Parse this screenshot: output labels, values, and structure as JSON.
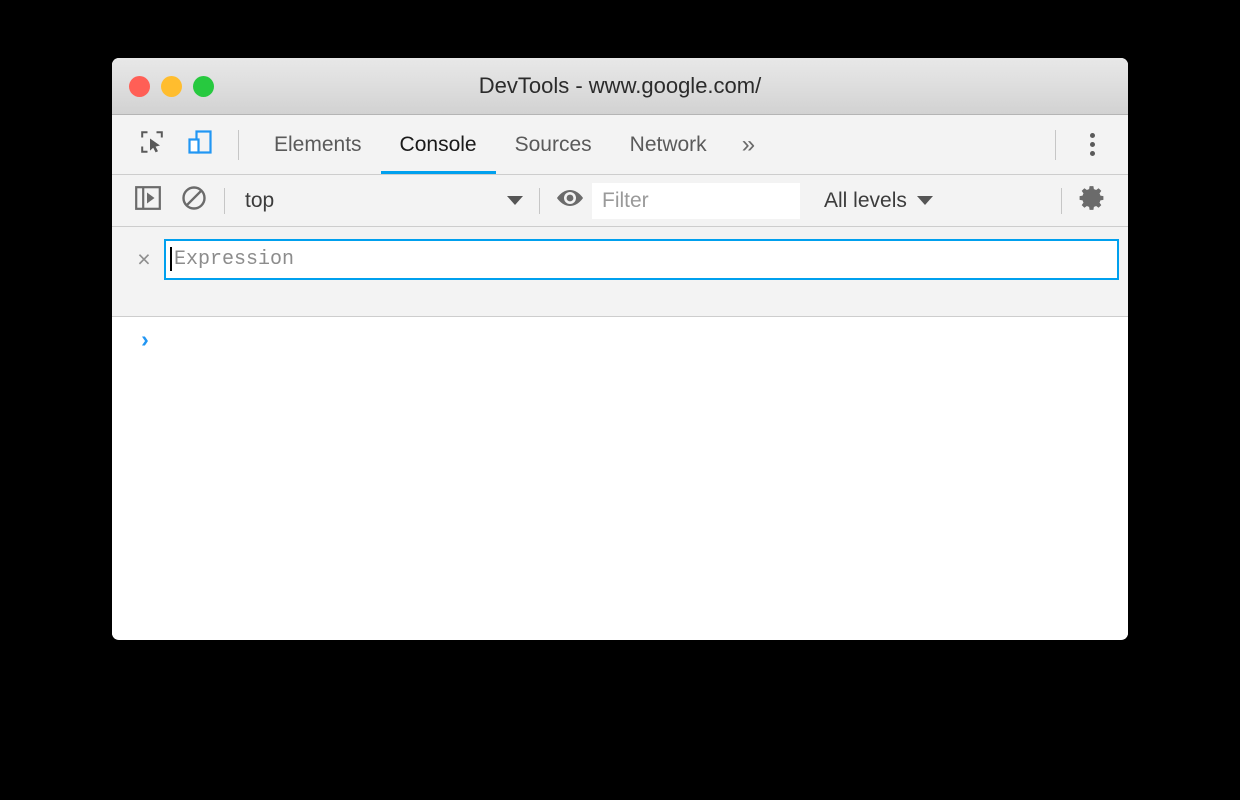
{
  "window": {
    "title": "DevTools - www.google.com/",
    "traffic_lights": [
      {
        "name": "close",
        "color": "#ff5f56"
      },
      {
        "name": "minimize",
        "color": "#ffbd2e"
      },
      {
        "name": "zoom",
        "color": "#27c93f"
      }
    ]
  },
  "tabbar": {
    "inspect_icon": "inspect-cursor-icon",
    "device_toolbar_icon": "device-toolbar-icon",
    "tabs": [
      {
        "label": "Elements",
        "active": false
      },
      {
        "label": "Console",
        "active": true
      },
      {
        "label": "Sources",
        "active": false
      },
      {
        "label": "Network",
        "active": false
      }
    ],
    "more_tabs_label": "»",
    "menu_icon": "kebab-menu-icon",
    "active_accent": "#00a0ee"
  },
  "console_toolbar": {
    "sidebar_toggle_icon": "console-sidebar-toggle-icon",
    "clear_console_icon": "clear-console-icon",
    "context": {
      "value": "top",
      "caret_icon": "chevron-down-icon"
    },
    "live_expression_icon": "eye-icon",
    "filter": {
      "value": "",
      "placeholder": "Filter"
    },
    "levels": {
      "value": "All levels",
      "caret_icon": "chevron-down-icon"
    },
    "settings_icon": "gear-icon"
  },
  "live_expression": {
    "close_icon": "×",
    "value": "",
    "placeholder": "Expression",
    "focused": true,
    "border_color": "#00a0ee"
  },
  "console_output": {
    "prompt_chevron": "›",
    "prompt_color": "#2196f3",
    "input_value": "",
    "messages": []
  }
}
